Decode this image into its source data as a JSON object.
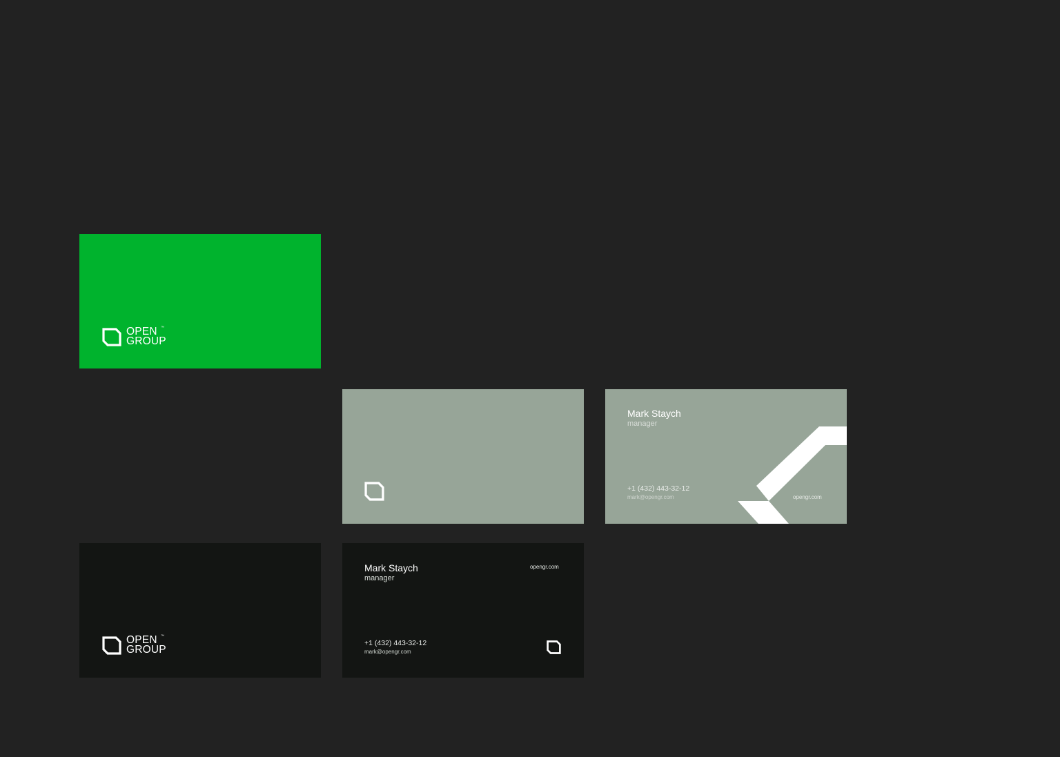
{
  "brand": {
    "line1": "OPEN",
    "line2": "GROUP",
    "trademark": "™"
  },
  "contact": {
    "name": "Mark Staych",
    "role": "manager",
    "phone": "+1 (432) 443-32-12",
    "email": "mark@opengr.com",
    "website": "opengr.com"
  },
  "colors": {
    "background": "#222222",
    "green": "#00b32d",
    "sage": "#97a598",
    "black": "#131513",
    "white": "#ffffff"
  },
  "icons": {
    "logo_mark": "open-group-logo-icon"
  }
}
